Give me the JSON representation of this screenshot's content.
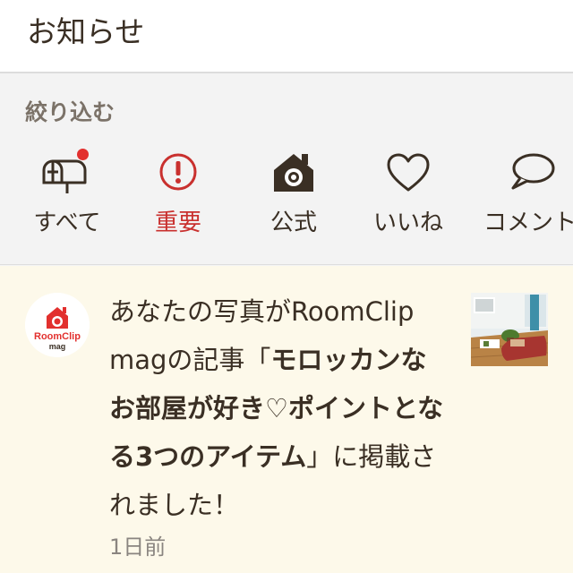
{
  "header": {
    "title": "お知らせ"
  },
  "filter": {
    "label": "絞り込む",
    "tabs": [
      {
        "id": "all",
        "label": "すべて",
        "icon": "mailbox-icon",
        "has_badge": true
      },
      {
        "id": "important",
        "label": "重要",
        "icon": "exclamation-circle-icon",
        "color": "#c9302e"
      },
      {
        "id": "official",
        "label": "公式",
        "icon": "house-camera-icon"
      },
      {
        "id": "likes",
        "label": "いいね",
        "icon": "heart-outline-icon"
      },
      {
        "id": "comments",
        "label": "コメント",
        "icon": "speech-bubble-icon"
      }
    ]
  },
  "notification": {
    "sender": {
      "logo_text": "RoomClip",
      "logo_subtext": "mag"
    },
    "text_prefix": "あなたの写真がRoomClip magの記事「",
    "article_title": "モロッカンなお部屋が好き♡ポイントとなる3つのアイテム",
    "text_suffix": "」に掲載されました！",
    "time": "1日前"
  },
  "colors": {
    "accent_red": "#e2302e",
    "important_red": "#c9302e",
    "notice_bg": "#fdf9ea",
    "text": "#3a2f24"
  }
}
